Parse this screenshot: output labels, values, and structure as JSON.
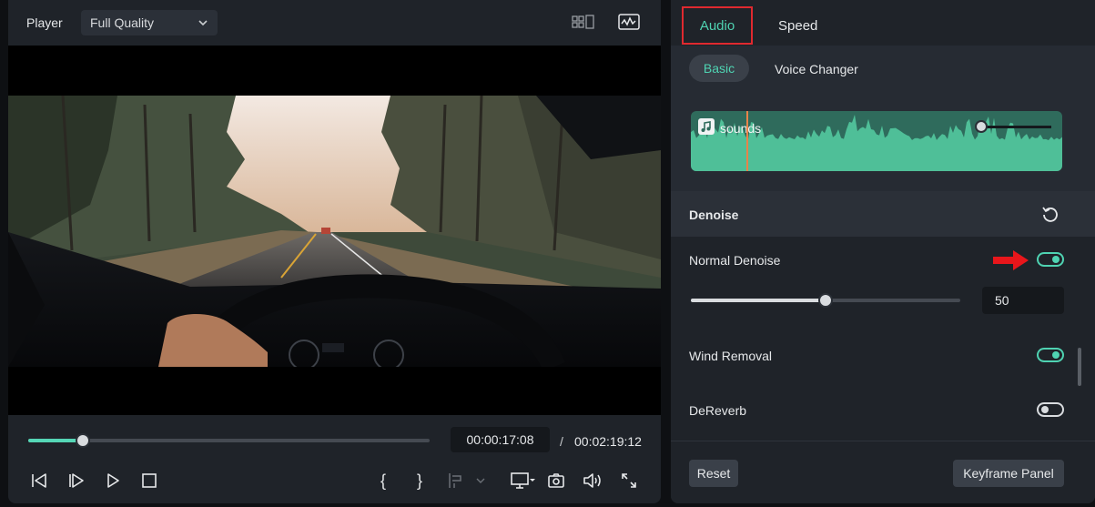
{
  "player": {
    "title": "Player",
    "quality": "Full Quality",
    "progress_fraction": 0.136,
    "time_current": "00:00:17:08",
    "time_separator": "/",
    "time_total": "00:02:19:12",
    "controls": [
      "step-back-icon",
      "step-forward-icon",
      "play-icon",
      "stop-icon",
      "mark-in-icon",
      "mark-out-icon",
      "clip-marker-icon",
      "display-icon",
      "snapshot-icon",
      "volume-icon",
      "fullscreen-icon"
    ],
    "mark_in_glyph": "{",
    "mark_out_glyph": "}"
  },
  "panel": {
    "tabs": {
      "audio": "Audio",
      "speed": "Speed"
    },
    "subtabs": {
      "basic": "Basic",
      "voice_changer": "Voice Changer"
    },
    "clip_name": "sounds",
    "section_title": "Denoise",
    "normal_denoise": {
      "label": "Normal Denoise",
      "enabled": true,
      "value": "50",
      "level_fraction": 0.5
    },
    "wind_removal": {
      "label": "Wind Removal",
      "enabled": true
    },
    "dereverb": {
      "label": "DeReverb",
      "enabled": false
    },
    "reset_label": "Reset",
    "keyframe_label": "Keyframe Panel"
  },
  "colors": {
    "accent": "#4fd3b2",
    "highlight_border": "#e0292f",
    "annotation_arrow": "#e8161b",
    "waveform": "#2f6b5c"
  }
}
